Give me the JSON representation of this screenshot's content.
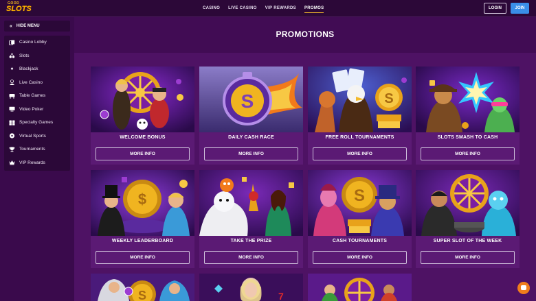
{
  "brand": {
    "logo_top": "GOOD",
    "logo_main": "SLOTS"
  },
  "nav": {
    "items": [
      {
        "label": "CASINO"
      },
      {
        "label": "LIVE CASINO"
      },
      {
        "label": "VIP REWARDS"
      },
      {
        "label": "PROMOS",
        "active": true
      }
    ],
    "login_label": "LOGIN",
    "join_label": "JOIN"
  },
  "sidebar": {
    "hide_label": "HIDE MENU",
    "items": [
      {
        "label": "Casino Lobby",
        "icon": "cards-icon"
      },
      {
        "label": "Slots",
        "icon": "cherry-icon"
      },
      {
        "label": "Blackjack",
        "icon": "spade-icon"
      },
      {
        "label": "Live Casino",
        "icon": "dealer-icon"
      },
      {
        "label": "Table Games",
        "icon": "table-icon"
      },
      {
        "label": "Video Poker",
        "icon": "monitor-icon"
      },
      {
        "label": "Specialty Games",
        "icon": "dice-icon"
      },
      {
        "label": "Virtual Sports",
        "icon": "soccer-ball-icon"
      },
      {
        "label": "Tournaments",
        "icon": "trophy-icon"
      },
      {
        "label": "VIP Rewards",
        "icon": "crown-icon"
      }
    ]
  },
  "page": {
    "title": "PROMOTIONS"
  },
  "promos": [
    {
      "title": "WELCOME BONUS",
      "button": "MORE INFO"
    },
    {
      "title": "DAILY CASH RACE",
      "button": "MORE INFO"
    },
    {
      "title": "FREE ROLL TOURNAMENTS",
      "button": "MORE INFO"
    },
    {
      "title": "SLOTS SMASH TO CASH",
      "button": "MORE INFO"
    },
    {
      "title": "WEEKLY LEADERBOARD",
      "button": "MORE INFO"
    },
    {
      "title": "TAKE THE PRIZE",
      "button": "MORE INFO"
    },
    {
      "title": "CASH TOURNAMENTS",
      "button": "MORE INFO"
    },
    {
      "title": "SUPER SLOT OF THE WEEK",
      "button": "MORE INFO"
    }
  ],
  "colors": {
    "accent": "#f2b92c",
    "join": "#3a8ee8",
    "chat": "#f07d1c"
  }
}
